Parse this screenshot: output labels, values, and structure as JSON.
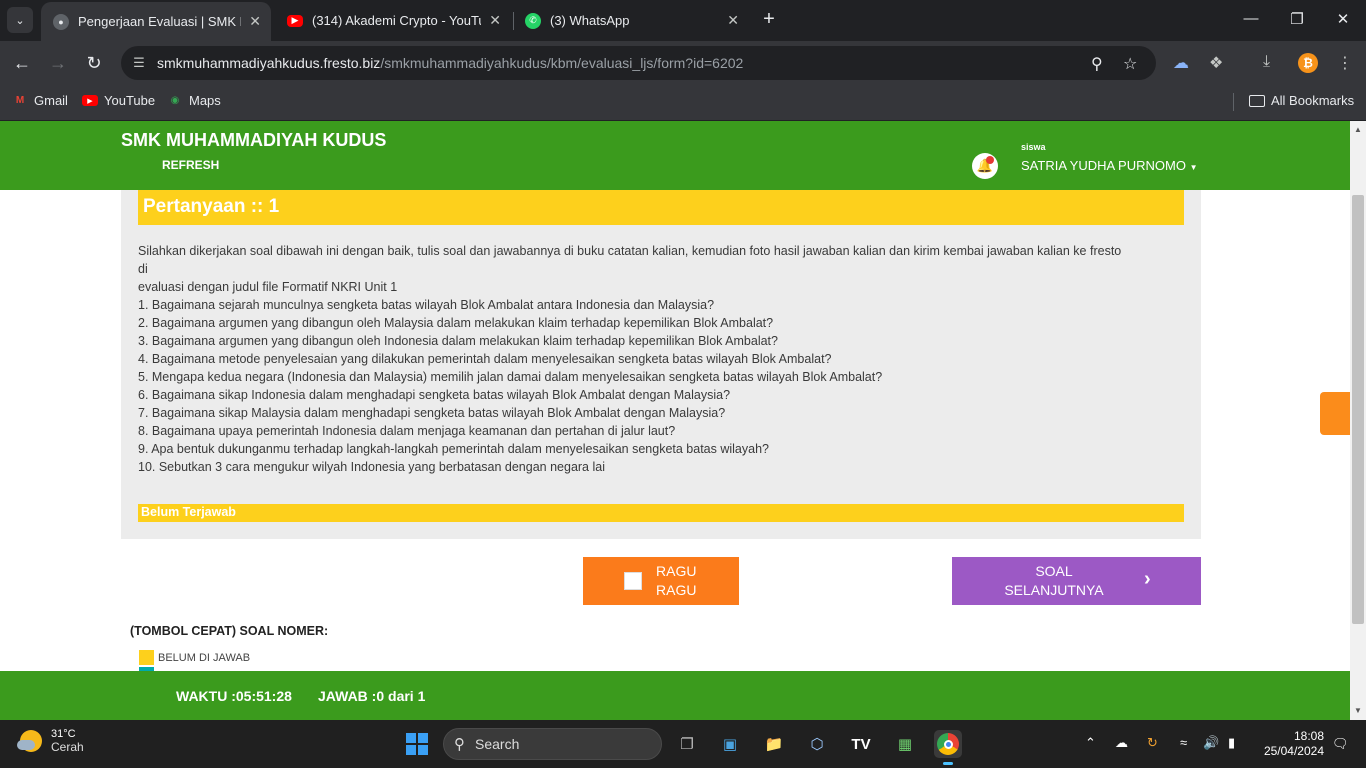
{
  "browser": {
    "tabs": [
      {
        "title": "Pengerjaan Evaluasi | SMK MUHAMMADIYAH KUDUS",
        "active": true,
        "icon": "globe-icon"
      },
      {
        "title": "(314) Akademi Crypto - YouTube",
        "active": false,
        "icon": "youtube-icon"
      },
      {
        "title": "(3) WhatsApp",
        "active": false,
        "icon": "whatsapp-icon"
      }
    ],
    "url_host": "smkmuhammadiyahkudus.fresto.biz",
    "url_path": "/smkmuhammadiyahkudus/kbm/evaluasi_ljs/form?id=6202",
    "bookmarks": [
      "Gmail",
      "YouTube",
      "Maps"
    ],
    "all_bookmarks": "All Bookmarks"
  },
  "header": {
    "brand": "SMK MUHAMMADIYAH KUDUS",
    "refresh": "REFRESH",
    "role": "siswa",
    "user_name": "SATRIA YUDHA PURNOMO"
  },
  "question": {
    "heading": "Pertanyaan :: 1",
    "lines": [
      "Silahkan dikerjakan soal dibawah ini dengan baik, tulis soal dan jawabannya di buku catatan kalian, kemudian foto hasil jawaban kalian dan kirim kembai jawaban kalian ke fresto",
      "di",
      "evaluasi dengan judul file Formatif NKRI Unit 1",
      "1. Bagaimana sejarah munculnya sengketa batas wilayah Blok Ambalat antara Indonesia dan Malaysia?",
      "2. Bagaimana argumen yang dibangun oleh Malaysia dalam melakukan klaim terhadap kepemilikan Blok Ambalat?",
      "3. Bagaimana argumen yang dibangun oleh Indonesia dalam melakukan klaim terhadap kepemilikan Blok Ambalat?",
      "4. Bagaimana metode penyelesaian yang dilakukan pemerintah dalam menyelesaikan sengketa batas wilayah Blok Ambalat?",
      "5. Mengapa kedua negara (Indonesia dan Malaysia) memilih jalan damai dalam menyelesaikan sengketa batas wilayah Blok Ambalat?",
      "6. Bagaimana sikap Indonesia dalam menghadapi sengketa batas wilayah Blok Ambalat dengan Malaysia?",
      "7. Bagaimana sikap Malaysia dalam menghadapi sengketa batas wilayah Blok Ambalat dengan Malaysia?",
      "8. Bagaimana upaya pemerintah Indonesia dalam menjaga keamanan dan pertahan di jalur laut?",
      "9. Apa bentuk dukunganmu terhadap langkah-langkah pemerintah dalam menyelesaikan sengketa batas wilayah?",
      "10. Sebutkan 3 cara mengukur wilyah Indonesia yang berbatasan dengan negara lai"
    ],
    "status": "Belum Terjawab"
  },
  "actions": {
    "ragu_line1": "RAGU",
    "ragu_line2": "RAGU",
    "next_line1": "SOAL",
    "next_line2": "SELANJUTNYA"
  },
  "quick": {
    "title": "(TOMBOL CEPAT) SOAL NOMER:",
    "legend_unanswered": "BELUM DI JAWAB"
  },
  "footer": {
    "time": "WAKTU :05:51:28",
    "answered": "JAWAB :0 dari 1"
  },
  "taskbar": {
    "temp": "31°C",
    "weather": "Cerah",
    "search": "Search",
    "time": "18:08",
    "date": "25/04/2024"
  },
  "colors": {
    "green": "#3b9b1d",
    "yellow": "#fdd01c",
    "orange": "#fb7b1b",
    "purple": "#9c59c5"
  }
}
